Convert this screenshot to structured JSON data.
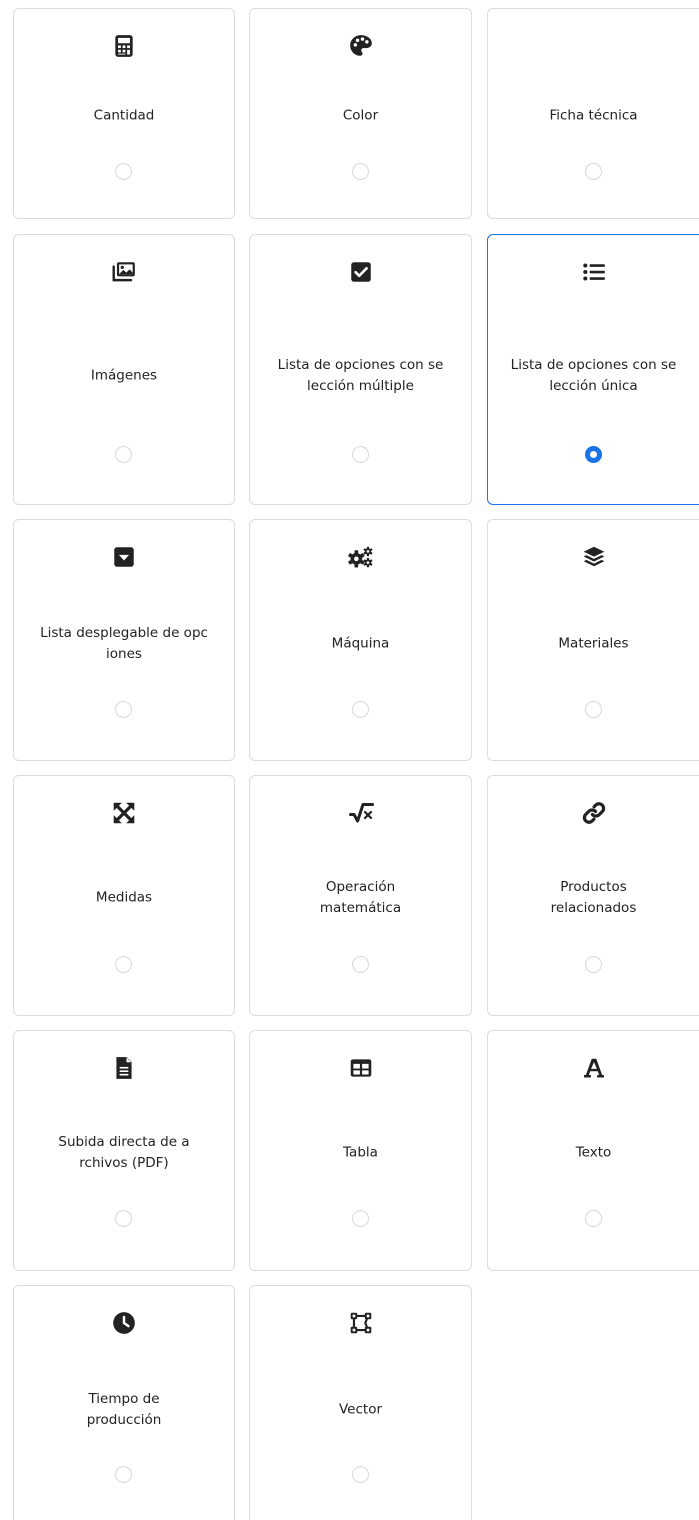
{
  "accent_color": "#1a73e8",
  "selected_option": "Lista de opciones con selección única",
  "options": [
    {
      "label": "Cantidad",
      "icon": "calculator-icon",
      "selected": false
    },
    {
      "label": "Color",
      "icon": "palette-icon",
      "selected": false
    },
    {
      "label": "Ficha técnica",
      "icon": "",
      "selected": false
    },
    {
      "label": "Imágenes",
      "icon": "images-icon",
      "selected": false
    },
    {
      "label": "Lista de opciones con selección múltiple",
      "icon": "square-check-icon",
      "selected": false
    },
    {
      "label": "Lista de opciones con selección única",
      "icon": "list-icon",
      "selected": true
    },
    {
      "label": "Lista desplegable de opciones",
      "icon": "caret-square-down-icon",
      "selected": false
    },
    {
      "label": "Máquina",
      "icon": "cogs-icon",
      "selected": false
    },
    {
      "label": "Materiales",
      "icon": "layer-group-icon",
      "selected": false
    },
    {
      "label": "Medidas",
      "icon": "expand-arrows-icon",
      "selected": false
    },
    {
      "label": "Operación matemática",
      "icon": "square-root-icon",
      "selected": false
    },
    {
      "label": "Productos relacionados",
      "icon": "link-icon",
      "selected": false
    },
    {
      "label": "Subida directa de archivos (PDF)",
      "icon": "file-icon",
      "selected": false
    },
    {
      "label": "Tabla",
      "icon": "table-icon",
      "selected": false
    },
    {
      "label": "Texto",
      "icon": "font-icon",
      "selected": false
    },
    {
      "label": "Tiempo de producción",
      "icon": "clock-icon",
      "selected": false
    },
    {
      "label": "Vector",
      "icon": "vector-square-icon",
      "selected": false
    }
  ]
}
